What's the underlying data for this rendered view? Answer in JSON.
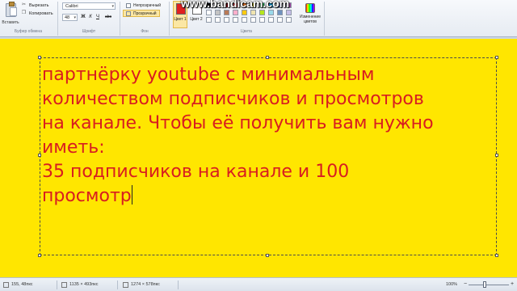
{
  "ribbon": {
    "clipboard": {
      "paste_label": "Вставить",
      "cut_label": "Вырезать",
      "copy_label": "Копировать",
      "group_label": "Буфер обмена"
    },
    "font": {
      "family": "Calibri",
      "size": "48",
      "bold": "Ж",
      "italic": "К",
      "underline": "Ч",
      "strike": "abc",
      "group_label": "Шрифт"
    },
    "background": {
      "opaque_label": "Непрозрачный",
      "transparent_label": "Прозрачный",
      "group_label": "Фон"
    },
    "colors": {
      "color1_label": "Цвет 1",
      "color1_value": "#e02020",
      "color2_label": "Цвет 2",
      "color2_value": "#ffffff",
      "edit_label": "Изменение цветов",
      "group_label": "Цвета",
      "palette": [
        "#000000",
        "#7f7f7f",
        "#880015",
        "#ed1c24",
        "#ff7f27",
        "#fff200",
        "#22b14c",
        "#00a2e8",
        "#3f48cc",
        "#a349a4",
        "#ffffff",
        "#c3c3c3",
        "#b97a57",
        "#ffaec9",
        "#ffc90e",
        "#efe4b0",
        "#b5e61d",
        "#99d9ea",
        "#7092be",
        "#c8bfe7",
        "#ffffff",
        "#ffffff",
        "#ffffff",
        "#ffffff",
        "#ffffff",
        "#ffffff",
        "#ffffff",
        "#ffffff",
        "#ffffff",
        "#ffffff"
      ]
    },
    "watermark": "www.bandicam.com"
  },
  "canvas": {
    "background": "#ffe600",
    "text_color": "#d81d20",
    "lines": [
      "партнёрку youtube  с минимальным",
      "количеством подписчиков и просмотров",
      "на канале. Чтобы её получить вам нужно",
      "иметь:",
      "35 подписчиков на канале и 100",
      "просмотр"
    ]
  },
  "statusbar": {
    "cursor_pos": "155, 48пкс",
    "selection_size": "1135 × 493пкс",
    "image_size": "1274 × 578пкс",
    "zoom": "100%"
  }
}
